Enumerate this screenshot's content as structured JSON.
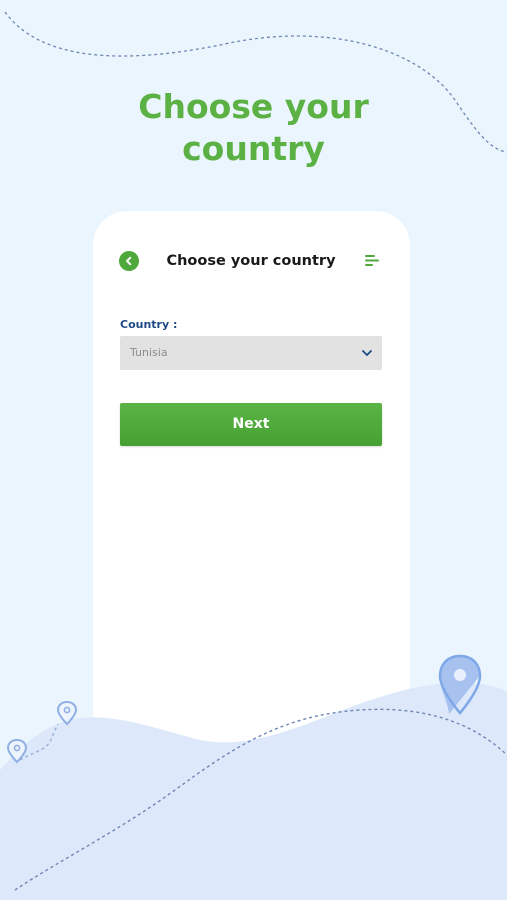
{
  "headline": {
    "line1": "Choose your",
    "line2": "country"
  },
  "screen": {
    "title": "Choose your country",
    "back_icon": "chevron-left-icon",
    "menu_icon": "menu-lines-icon"
  },
  "form": {
    "country_label": "Country :",
    "country_value": "Tunisia",
    "dropdown_icon": "chevron-down-icon",
    "next_label": "Next"
  },
  "colors": {
    "accent_green": "#5bb143",
    "label_blue": "#1d4a85",
    "background": "#eaf5fd",
    "wave": "#dde9fb",
    "pin_blue": "#7fa8e8"
  }
}
